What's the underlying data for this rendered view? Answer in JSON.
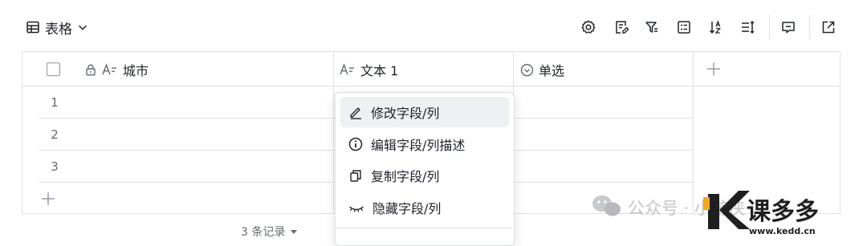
{
  "view": {
    "label": "表格"
  },
  "table": {
    "columns": [
      {
        "label": "城市"
      },
      {
        "label": "文本 1"
      },
      {
        "label": "单选"
      }
    ],
    "rows": [
      "1",
      "2",
      "3"
    ]
  },
  "context_menu": {
    "items": [
      {
        "label": "修改字段/列",
        "icon": "pencil-icon"
      },
      {
        "label": "编辑字段/列描述",
        "icon": "info-icon"
      },
      {
        "label": "复制字段/列",
        "icon": "copy-icon"
      },
      {
        "label": "隐藏字段/列",
        "icon": "eye-closed-icon"
      }
    ]
  },
  "footer": {
    "record_count": "3 条记录"
  },
  "watermark": {
    "wechat": "公众号 · 小游侠",
    "brand": "课多多",
    "url": "www.kedd.cn"
  }
}
